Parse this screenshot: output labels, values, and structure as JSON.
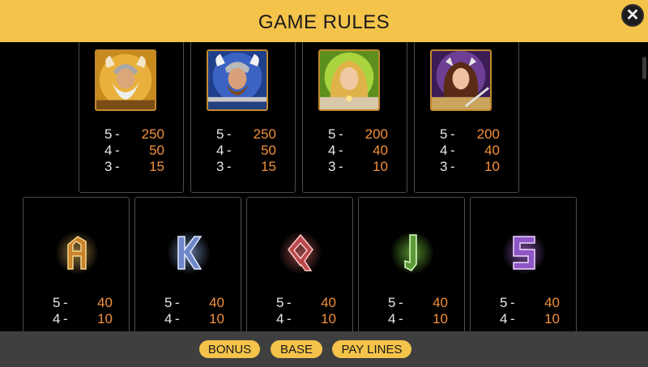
{
  "header": {
    "title": "GAME RULES",
    "close_label": "✕"
  },
  "premium_symbols": [
    {
      "icon": "odin-portrait-icon",
      "pays": [
        {
          "count": "5",
          "amount": "250"
        },
        {
          "count": "4",
          "amount": "50"
        },
        {
          "count": "3",
          "amount": "15"
        }
      ]
    },
    {
      "icon": "thor-portrait-icon",
      "pays": [
        {
          "count": "5",
          "amount": "250"
        },
        {
          "count": "4",
          "amount": "50"
        },
        {
          "count": "3",
          "amount": "15"
        }
      ]
    },
    {
      "icon": "freya-portrait-icon",
      "pays": [
        {
          "count": "5",
          "amount": "200"
        },
        {
          "count": "4",
          "amount": "40"
        },
        {
          "count": "3",
          "amount": "10"
        }
      ]
    },
    {
      "icon": "valkyrie-portrait-icon",
      "pays": [
        {
          "count": "5",
          "amount": "200"
        },
        {
          "count": "4",
          "amount": "40"
        },
        {
          "count": "3",
          "amount": "10"
        }
      ]
    }
  ],
  "rune_symbols": [
    {
      "icon": "rune-a-icon",
      "color": "#e7b14a",
      "pays": [
        {
          "count": "5",
          "amount": "40"
        },
        {
          "count": "4",
          "amount": "10"
        }
      ]
    },
    {
      "icon": "rune-k-icon",
      "color": "#8fa8ff",
      "pays": [
        {
          "count": "5",
          "amount": "40"
        },
        {
          "count": "4",
          "amount": "10"
        }
      ]
    },
    {
      "icon": "rune-q-icon",
      "color": "#ff5a5a",
      "pays": [
        {
          "count": "5",
          "amount": "40"
        },
        {
          "count": "4",
          "amount": "10"
        }
      ]
    },
    {
      "icon": "rune-j-icon",
      "color": "#7ee04a",
      "pays": [
        {
          "count": "5",
          "amount": "40"
        },
        {
          "count": "4",
          "amount": "10"
        }
      ]
    },
    {
      "icon": "rune-s-icon",
      "color": "#c06bff",
      "pays": [
        {
          "count": "5",
          "amount": "40"
        },
        {
          "count": "4",
          "amount": "10"
        }
      ]
    }
  ],
  "footer": {
    "tabs": [
      {
        "label": "BONUS"
      },
      {
        "label": "BASE"
      },
      {
        "label": "PAY LINES"
      }
    ]
  },
  "colors": {
    "header": "#f4c34a",
    "amount": "#f0913a",
    "background": "#000000",
    "footer": "#3f3f3f"
  }
}
